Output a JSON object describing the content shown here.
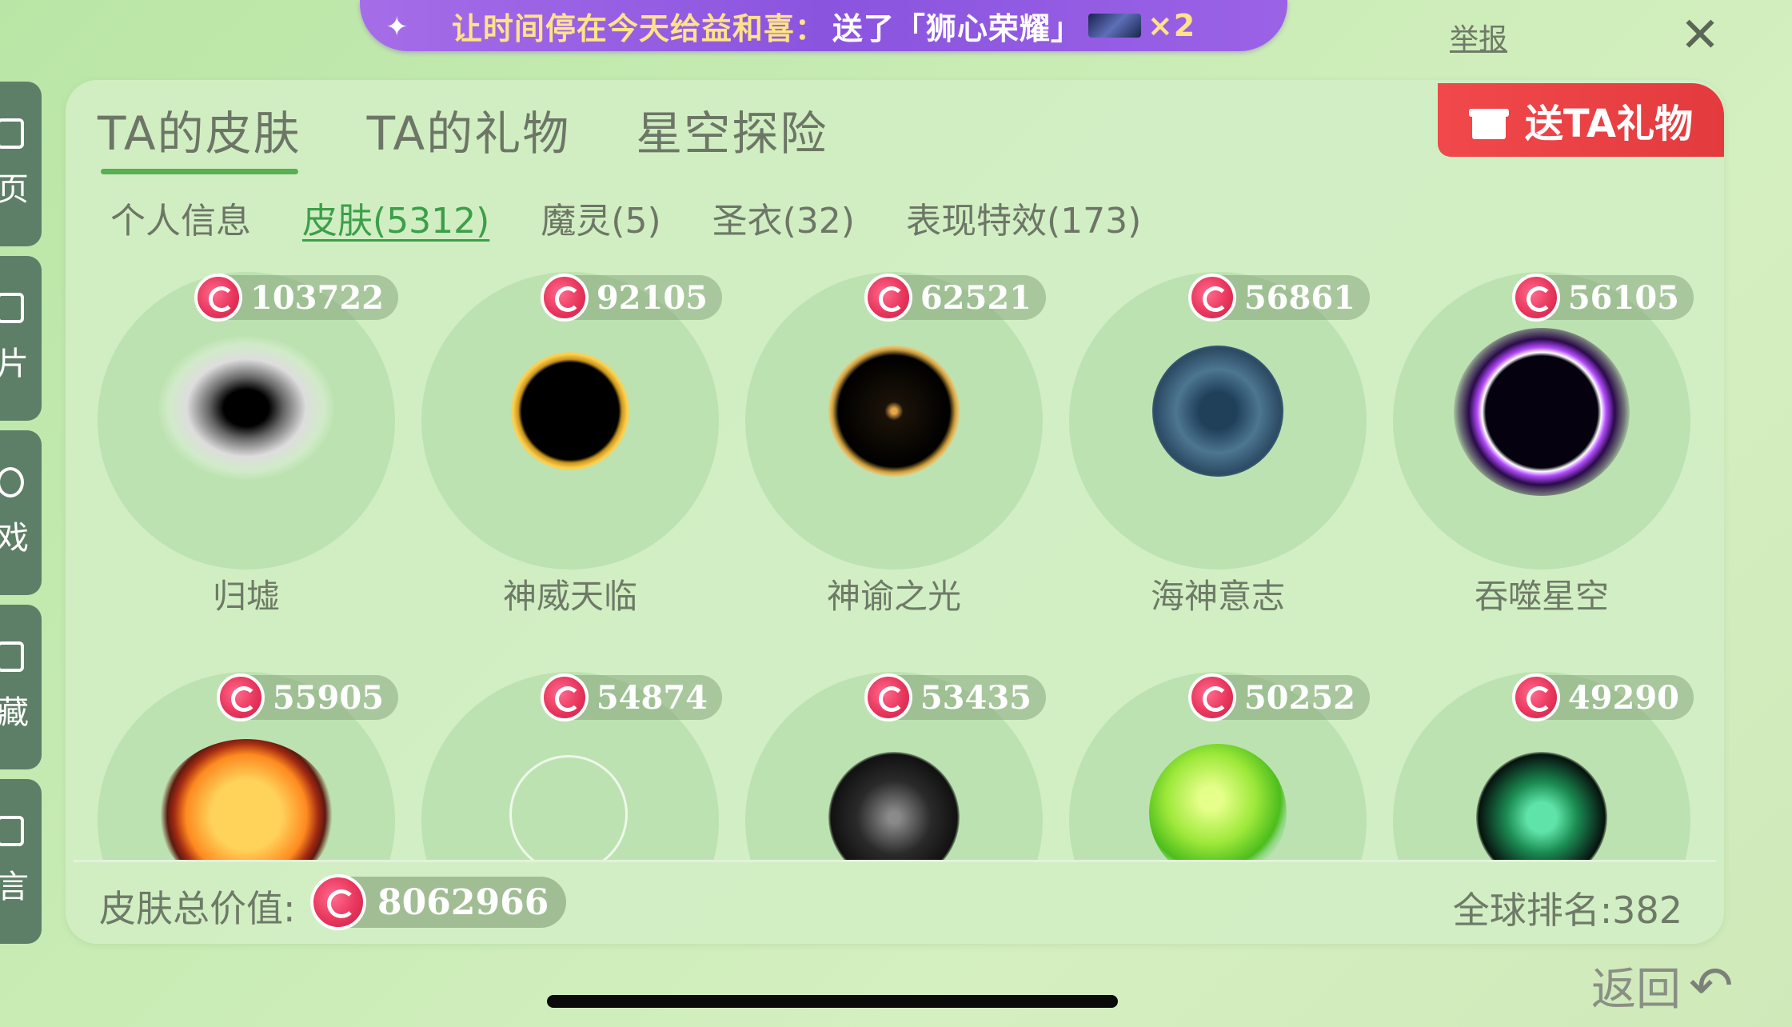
{
  "banner": {
    "message": "让时间停在今天给益和喜：",
    "action": "送了「狮心荣耀」",
    "count": "×2"
  },
  "report_label": "举报",
  "rail": [
    "页",
    "片",
    "戏",
    "藏",
    "言"
  ],
  "tabs": [
    "TA的皮肤",
    "TA的礼物",
    "星空探险"
  ],
  "send_gift_label": "送TA礼物",
  "subtabs": [
    "个人信息",
    "皮肤(5312)",
    "魔灵(5)",
    "圣衣(32)",
    "表现特效(173)"
  ],
  "skins": [
    {
      "name": "归墟",
      "price": "103722"
    },
    {
      "name": "神威天临",
      "price": "92105"
    },
    {
      "name": "神谕之光",
      "price": "62521"
    },
    {
      "name": "海神意志",
      "price": "56861"
    },
    {
      "name": "吞噬星空",
      "price": "56105"
    },
    {
      "name": "",
      "price": "55905"
    },
    {
      "name": "",
      "price": "54874"
    },
    {
      "name": "",
      "price": "53435"
    },
    {
      "name": "",
      "price": "50252"
    },
    {
      "name": "",
      "price": "49290"
    }
  ],
  "footer": {
    "total_label": "皮肤总价值:",
    "total_value": "8062966",
    "rank_label": "全球排名:382"
  },
  "back_label": "返回"
}
